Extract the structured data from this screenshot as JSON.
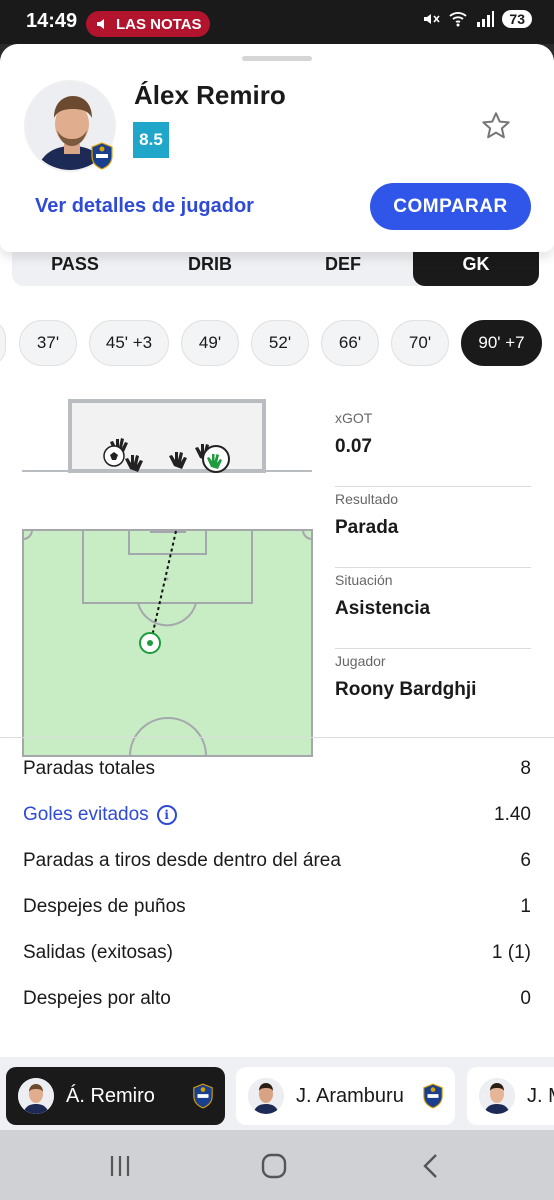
{
  "status_bar": {
    "time": "14:49",
    "live_label": "LAS NOTAS",
    "battery": "73"
  },
  "player": {
    "name": "Álex Remiro",
    "rating": "8.5",
    "details_link": "Ver detalles de jugador",
    "compare_label": "COMPARAR",
    "rating_color": "#1fa6c9"
  },
  "tabs": [
    "PASS",
    "DRIB",
    "DEF",
    "GK"
  ],
  "active_tab": "GK",
  "minutes": [
    "37'",
    "45' +3",
    "49'",
    "52'",
    "66'",
    "70'",
    "90' +7"
  ],
  "active_minute": "90' +7",
  "shot": {
    "xgot_label": "xGOT",
    "xgot_value": "0.07",
    "result_label": "Resultado",
    "result_value": "Parada",
    "situation_label": "Situación",
    "situation_value": "Asistencia",
    "player_label": "Jugador",
    "player_value": "Roony Bardghji"
  },
  "stats": [
    {
      "label": "Paradas totales",
      "value": "8"
    },
    {
      "label": "Goles evitados",
      "value": "1.40",
      "link": true
    },
    {
      "label": "Paradas a tiros desde dentro del área",
      "value": "6"
    },
    {
      "label": "Despejes de puños",
      "value": "1"
    },
    {
      "label": "Salidas (exitosas)",
      "value": "1 (1)"
    },
    {
      "label": "Despejes por alto",
      "value": "0"
    }
  ],
  "player_strip": [
    {
      "name": "Á. Remiro",
      "active": true
    },
    {
      "name": "J. Aramburu",
      "active": false
    },
    {
      "name": "J. M",
      "active": false
    }
  ],
  "colors": {
    "accent_blue": "#2f56e8",
    "link_blue": "#2f4ad6",
    "pitch_green": "#c8ecc3",
    "save_green": "#1f9b3f"
  }
}
